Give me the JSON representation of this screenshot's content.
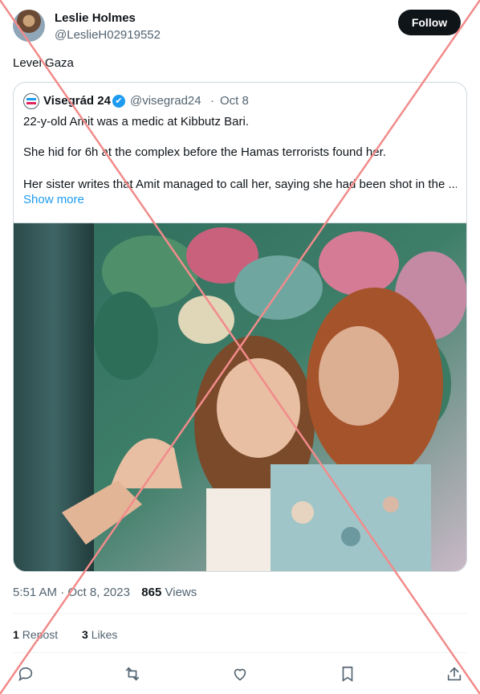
{
  "tweet": {
    "author_name": "Leslie Holmes",
    "author_handle": "@LeslieH02919552",
    "follow_label": "Follow",
    "text": "Level Gaza"
  },
  "quote": {
    "name": "Visegrád 24",
    "verified_icon": "✔",
    "handle": "@visegrad24",
    "separator": "·",
    "date": "Oct 8",
    "line1": "22-y-old Amit was a medic at Kibbutz Bari.",
    "line2": "She hid for 6h at the complex before the Hamas terrorists found her.",
    "line3": "Her sister writes that Amit managed to call her, saying she had been shot in the ...",
    "show_more": "Show more"
  },
  "meta": {
    "time": "5:51 AM",
    "separator": "·",
    "date": "Oct 8, 2023",
    "views_count": "865",
    "views_label": "Views"
  },
  "stats": {
    "reposts_count": "1",
    "reposts_label": "Repost",
    "likes_count": "3",
    "likes_label": "Likes"
  },
  "icons": {
    "reply": "reply-icon",
    "repost": "repost-icon",
    "like": "heart-icon",
    "bookmark": "bookmark-icon",
    "share": "share-icon"
  },
  "colors": {
    "accent": "#1d9bf0",
    "text": "#0f1419",
    "secondary": "#536471",
    "overlay_cross": "#f28b8b"
  }
}
